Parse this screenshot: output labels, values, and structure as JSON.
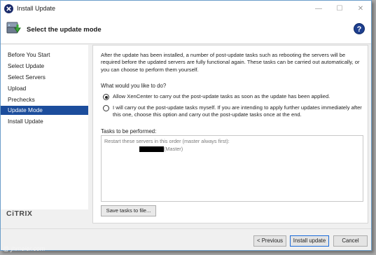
{
  "window": {
    "title": "Install Update",
    "icons": {
      "app": "xencenter-x-icon",
      "minimize": "minimize-icon",
      "maximize": "maximize-icon",
      "close": "close-icon"
    }
  },
  "header": {
    "title": "Select the update mode",
    "icon": "install-update-icon",
    "help_label": "?"
  },
  "nav": {
    "items": [
      {
        "label": "Before You Start",
        "active": false
      },
      {
        "label": "Select Update",
        "active": false
      },
      {
        "label": "Select Servers",
        "active": false
      },
      {
        "label": "Upload",
        "active": false
      },
      {
        "label": "Prechecks",
        "active": false
      },
      {
        "label": "Update Mode",
        "active": true
      },
      {
        "label": "Install Update",
        "active": false
      }
    ],
    "logo": "CiTRIX"
  },
  "main": {
    "description": "After the update has been installed, a number of post-update tasks such as rebooting the servers will be required before the updated servers are fully functional again. These tasks can be carried out automatically, or you can choose to perform them yourself.",
    "question": "What would you like to do?",
    "options": [
      {
        "label": "Allow XenCenter to carry out the post-update tasks as soon as the update has been applied.",
        "selected": true
      },
      {
        "label": "I will carry out the post-update tasks myself. If you are intending to apply further updates immediately after this one, choose this option and carry out the post-update tasks once at the end.",
        "selected": false
      }
    ],
    "tasks_label": "Tasks to be performed:",
    "tasks": {
      "line1": "Restart these servers in this order (master always first):",
      "server_suffix": "(Master)"
    },
    "save_button": "Save tasks to file..."
  },
  "footer": {
    "previous": "< Previous",
    "install": "Install update",
    "cancel": "Cancel"
  },
  "watermark": "@ jhmeier.com",
  "colors": {
    "accent": "#1c4d9c",
    "primary_border": "#1c6bd8"
  }
}
